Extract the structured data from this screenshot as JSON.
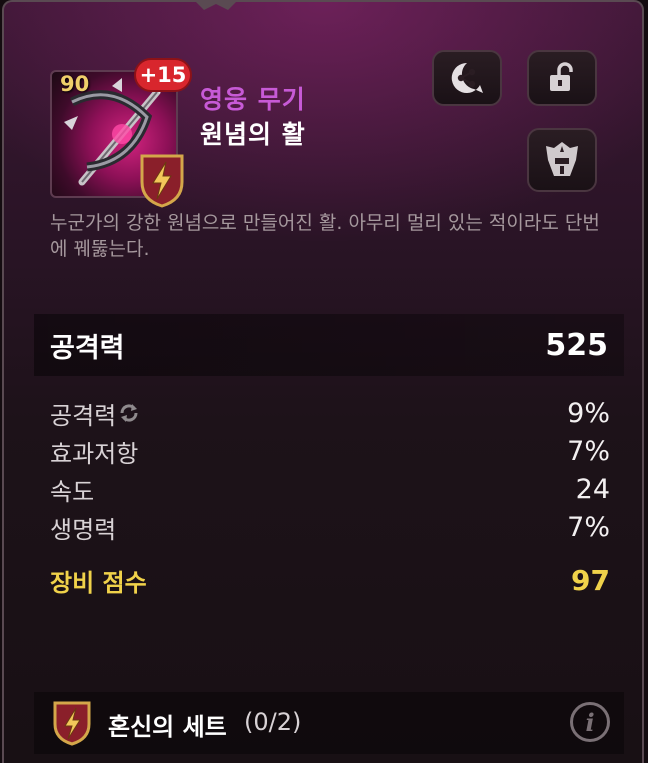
{
  "item": {
    "level": "90",
    "enhance": "+15",
    "rarity": "영웅 무기",
    "name": "원념의 활",
    "description": "누군가의 강한 원념으로 만들어진 활. 아무리 멀리 있는 적이라도 단번에 꿰뚫는다."
  },
  "buttons": {
    "share_icon": "share-icon",
    "lock_icon": "unlock-icon",
    "equip_icon": "hero-helmet-icon"
  },
  "main_stat": {
    "label": "공격력",
    "value": "525"
  },
  "substats": [
    {
      "label": "공격력",
      "value": "9%",
      "reforge_icon": true
    },
    {
      "label": "효과저항",
      "value": "7%"
    },
    {
      "label": "속도",
      "value": "24"
    },
    {
      "label": "생명력",
      "value": "7%"
    }
  ],
  "gear_score": {
    "label": "장비 점수",
    "value": "97"
  },
  "set": {
    "name": "혼신의 세트",
    "count": "(0/2)",
    "info_label": "i"
  },
  "colors": {
    "rarity": "#c75ad6",
    "score": "#f0d24a",
    "enhance_badge": "#d8262d",
    "set_shield": "#8a1f2a"
  }
}
